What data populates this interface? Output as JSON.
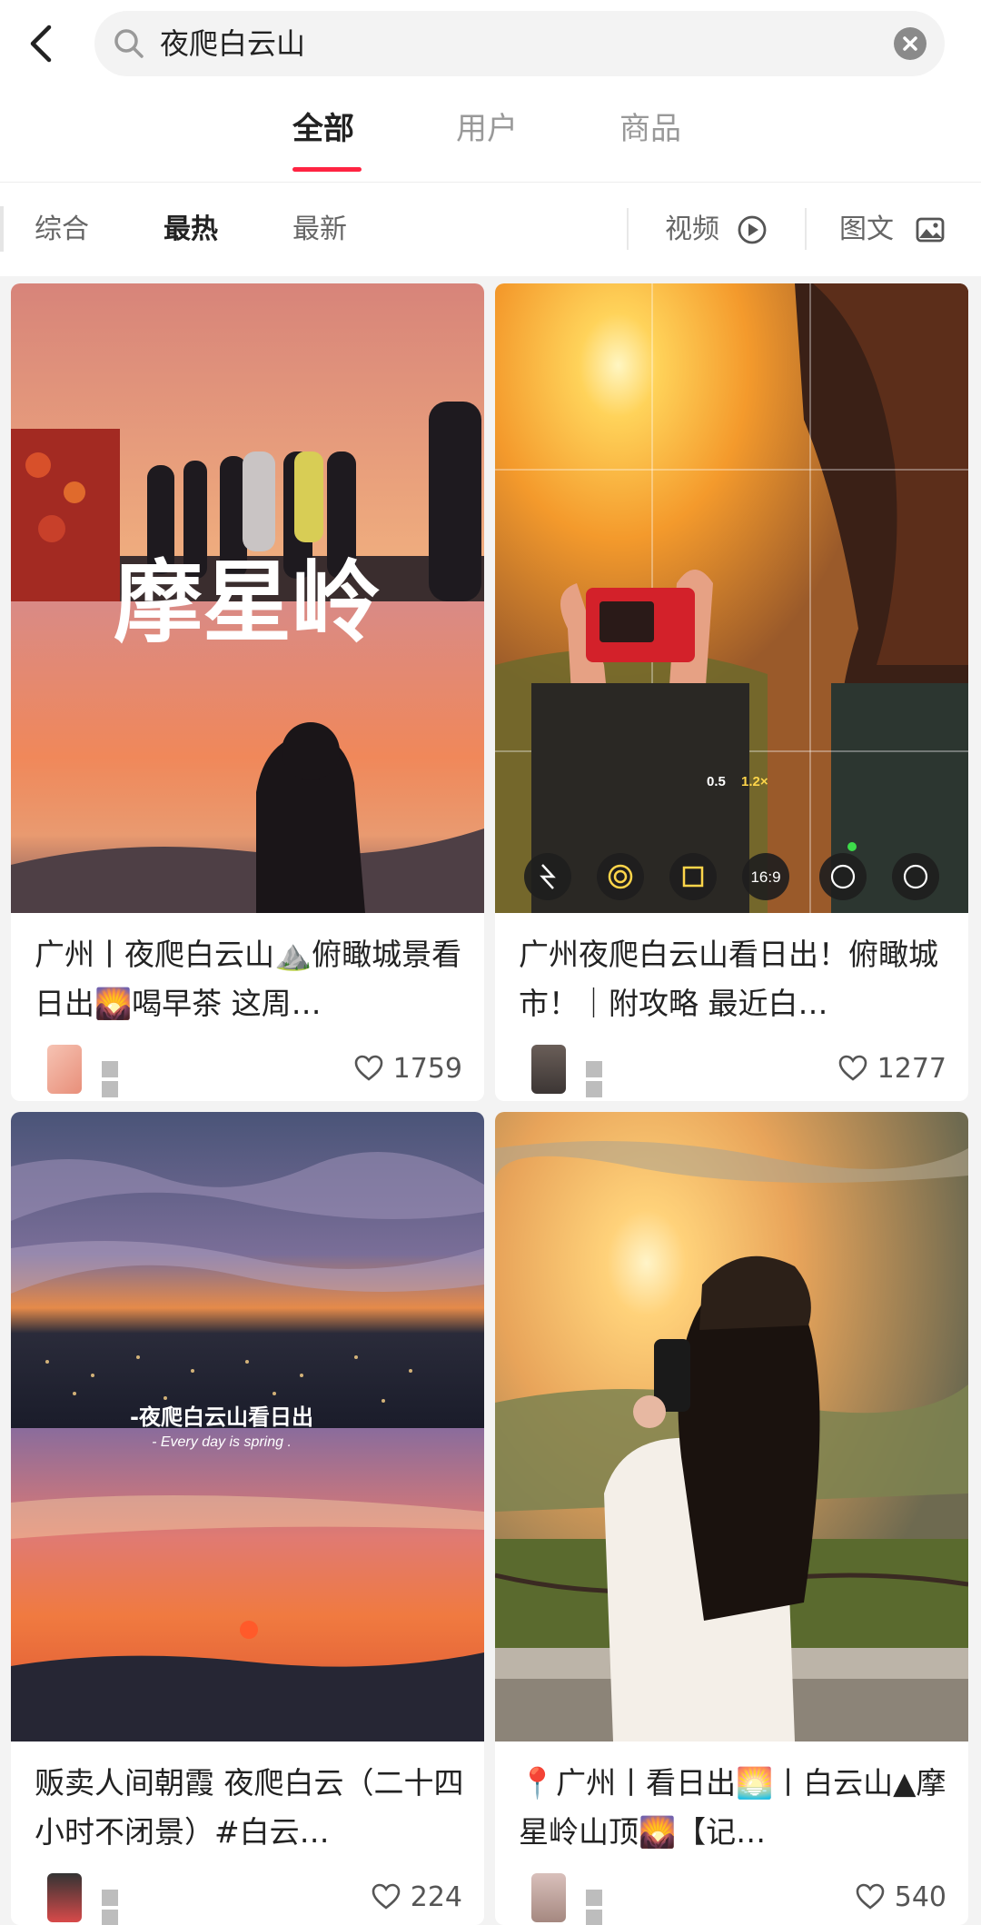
{
  "search": {
    "query": "夜爬白云山"
  },
  "tabs": [
    {
      "label": "全部"
    },
    {
      "label": "用户"
    },
    {
      "label": "商品"
    }
  ],
  "filters": {
    "sort": [
      {
        "label": "综合"
      },
      {
        "label": "最热"
      },
      {
        "label": "最新"
      }
    ],
    "video_label": "视频",
    "image_text_label": "图文"
  },
  "colors": {
    "accent": "#ff2442"
  },
  "posts": [
    {
      "title": "广州丨夜爬白云山⛰️俯瞰城景看日出🌄喝早茶 这周…",
      "likes": "1759",
      "image_text": "摩星岭"
    },
    {
      "title": "广州夜爬白云山看日出！俯瞰城市！｜附攻略 最近白…",
      "likes": "1277",
      "camera_zoom": [
        "0.5",
        "1.2×"
      ],
      "camera_ratio": "16:9"
    },
    {
      "title": "贩卖人间朝霞 夜爬白云（二十四小时不闭景）#白云…",
      "likes": "224",
      "image_caption": "-夜爬白云山看日出",
      "image_caption_en": "- Every day is spring ."
    },
    {
      "title": "📍广州丨看日出🌅丨白云山▲摩星岭山顶🌄【记…",
      "likes": "540"
    }
  ]
}
